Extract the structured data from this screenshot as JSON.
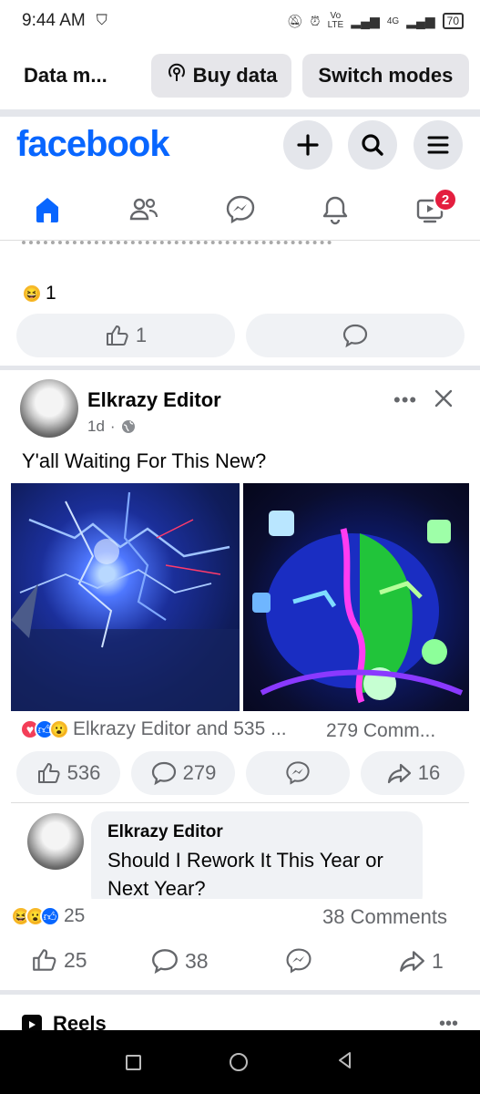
{
  "status_bar": {
    "time": "9:44 AM",
    "net": "Vo LTE",
    "net2": "4G",
    "battery": "70"
  },
  "data_bar": {
    "label": "Data m...",
    "buy_data": "Buy data",
    "switch_modes": "Switch modes"
  },
  "header": {
    "logo": "facebook",
    "nav": [
      "home-icon",
      "friends-icon",
      "messenger-icon",
      "bell-icon",
      "video-icon"
    ],
    "video_badge": "2"
  },
  "post_prev": {
    "reaction_count": "1",
    "like_count": "1"
  },
  "post": {
    "author": "Elkrazy Editor",
    "time": "1d",
    "dot": "·",
    "text": "Y'all Waiting For This New?",
    "reactions_text": "Elkrazy Editor and 535 ...",
    "comments_text": "279 Comm...",
    "like_count": "536",
    "comment_count": "279",
    "share_count": "16"
  },
  "comment": {
    "author": "Elkrazy Editor",
    "text": "Should I Rework It This Year or Next Year?"
  },
  "post_next": {
    "reaction_count": "25",
    "comments_text": "38 Comments",
    "like_count": "25",
    "comment_count": "38",
    "share_count": "1",
    "reels_label": "Reels"
  },
  "colors": {
    "brand": "#0866ff",
    "badge": "#e41e3f",
    "muted": "#65676b"
  }
}
